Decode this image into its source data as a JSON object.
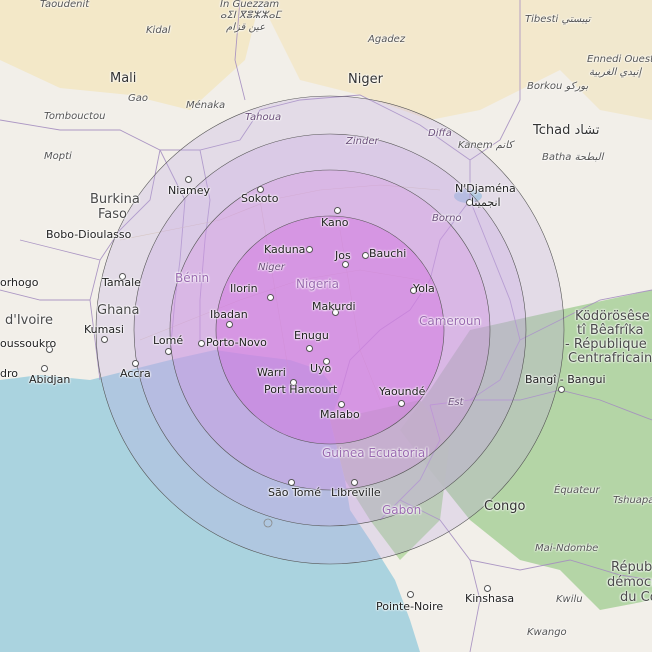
{
  "map": {
    "colors": {
      "land": "#f2efe9",
      "ocean": "#aad3df",
      "desert": "#f3e6bf",
      "forest": "#a9d09a",
      "border": "#a58ec0",
      "ring_outer": "#bfa9e2",
      "ring_inner": "#d36ee0"
    },
    "labels": [
      {
        "id": "taoudenit",
        "text": "Taoudenit",
        "cls": "ital-dark"
      },
      {
        "id": "in-guezzam-1",
        "text": "In Guezzam",
        "cls": "ital-dark"
      },
      {
        "id": "in-guezzam-2",
        "text": "ⴰⵉⵏ ⴳⴻⵣⵣⴰⵎ",
        "cls": "ital-dark"
      },
      {
        "id": "in-guezzam-3",
        "text": "عين قزام",
        "cls": "ital-dark"
      },
      {
        "id": "tibesti",
        "text": "Tibesti تيبستي",
        "cls": "ital-dark"
      },
      {
        "id": "kidal",
        "text": "Kidal",
        "cls": "ital-dark"
      },
      {
        "id": "agadez",
        "text": "Agadez",
        "cls": "ital-dark"
      },
      {
        "id": "ennedi-1",
        "text": "Ennedi Ouest",
        "cls": "ital-dark"
      },
      {
        "id": "ennedi-2",
        "text": "إنيدي الغربية",
        "cls": "ital-dark"
      },
      {
        "id": "mali",
        "text": "Mali",
        "cls": "country-big"
      },
      {
        "id": "niger",
        "text": "Niger",
        "cls": "country-big"
      },
      {
        "id": "borkou",
        "text": "Borkou بوركو",
        "cls": "ital-dark"
      },
      {
        "id": "gao",
        "text": "Gao",
        "cls": "ital-dark"
      },
      {
        "id": "menaka",
        "text": "Ménaka",
        "cls": "ital-dark"
      },
      {
        "id": "tombouctou",
        "text": "Tombouctou",
        "cls": "ital-dark"
      },
      {
        "id": "tahoua",
        "text": "Tahoua",
        "cls": "region"
      },
      {
        "id": "diffa",
        "text": "Diffa",
        "cls": "region"
      },
      {
        "id": "kanem",
        "text": "Kanem كانم",
        "cls": "ital-dark"
      },
      {
        "id": "tchad",
        "text": "Tchad تشاد",
        "cls": "country-big"
      },
      {
        "id": "zinder",
        "text": "Zinder",
        "cls": "region"
      },
      {
        "id": "batha",
        "text": "Batha البطحة",
        "cls": "ital-dark"
      },
      {
        "id": "mopti",
        "text": "Mopti",
        "cls": "ital-dark"
      },
      {
        "id": "niamey",
        "text": "Niamey",
        "cls": "city"
      },
      {
        "id": "ndjamena-1",
        "text": "N'Djaména",
        "cls": "city"
      },
      {
        "id": "ndjamena-2",
        "text": "انجمينا",
        "cls": "city"
      },
      {
        "id": "burkina-1",
        "text": "Burkina",
        "cls": "country"
      },
      {
        "id": "burkina-2",
        "text": "Faso",
        "cls": "country"
      },
      {
        "id": "sokoto",
        "text": "Sokoto",
        "cls": "city"
      },
      {
        "id": "borno",
        "text": "Borno",
        "cls": "region"
      },
      {
        "id": "kano",
        "text": "Kano",
        "cls": "city"
      },
      {
        "id": "bobo",
        "text": "Bobo-Dioulasso",
        "cls": "city"
      },
      {
        "id": "kaduna",
        "text": "Kaduna",
        "cls": "city"
      },
      {
        "id": "bauchi",
        "text": "Bauchi",
        "cls": "city"
      },
      {
        "id": "jos",
        "text": "Jos",
        "cls": "city"
      },
      {
        "id": "benin",
        "text": "Bénin",
        "cls": "purple-country"
      },
      {
        "id": "niger-region",
        "text": "Niger",
        "cls": "region"
      },
      {
        "id": "korhogo",
        "text": "orhogo",
        "cls": "city"
      },
      {
        "id": "tamale",
        "text": "Tamale",
        "cls": "city"
      },
      {
        "id": "nigeria",
        "text": "Nigeria",
        "cls": "purple-country"
      },
      {
        "id": "ilorin",
        "text": "Ilorin",
        "cls": "city"
      },
      {
        "id": "yola",
        "text": "Yola",
        "cls": "city"
      },
      {
        "id": "ghana",
        "text": "Ghana",
        "cls": "country"
      },
      {
        "id": "makurdi",
        "text": "Makurdi",
        "cls": "city"
      },
      {
        "id": "ivoire",
        "text": "d'Ivoire",
        "cls": "country"
      },
      {
        "id": "ibadan",
        "text": "Ibadan",
        "cls": "city"
      },
      {
        "id": "cameroun",
        "text": "Cameroun",
        "cls": "purple-country"
      },
      {
        "id": "kodorosese",
        "text": "Ködörösêse",
        "cls": "country"
      },
      {
        "id": "beafrika",
        "text": "tî Bêafrîka",
        "cls": "country"
      },
      {
        "id": "kumasi",
        "text": "Kumasi",
        "cls": "city"
      },
      {
        "id": "republique",
        "text": "- République",
        "cls": "country"
      },
      {
        "id": "enugu",
        "text": "Enugu",
        "cls": "city"
      },
      {
        "id": "yamoussoukro",
        "text": "oussoukro",
        "cls": "city"
      },
      {
        "id": "lome",
        "text": "Lomé",
        "cls": "city"
      },
      {
        "id": "porto-novo",
        "text": "Porto-Novo",
        "cls": "city"
      },
      {
        "id": "centrafricaine",
        "text": "Centrafricaine",
        "cls": "country"
      },
      {
        "id": "uyo",
        "text": "Uyo",
        "cls": "city"
      },
      {
        "id": "dro",
        "text": "dro",
        "cls": "city"
      },
      {
        "id": "abidjan",
        "text": "Abidjan",
        "cls": "city"
      },
      {
        "id": "accra",
        "text": "Accra",
        "cls": "city"
      },
      {
        "id": "warri",
        "text": "Warri",
        "cls": "city"
      },
      {
        "id": "bangui",
        "text": "Bangî - Bangui",
        "cls": "city"
      },
      {
        "id": "port-harcourt",
        "text": "Port Harcourt",
        "cls": "city"
      },
      {
        "id": "yaounde",
        "text": "Yaoundé",
        "cls": "city"
      },
      {
        "id": "est",
        "text": "Est",
        "cls": "region"
      },
      {
        "id": "malabo",
        "text": "Malabo",
        "cls": "city"
      },
      {
        "id": "guinea",
        "text": "Guinea Ecuatorial",
        "cls": "purple-country"
      },
      {
        "id": "equateur",
        "text": "Équateur",
        "cls": "ital-dark"
      },
      {
        "id": "tshuapa",
        "text": "Tshuapa",
        "cls": "ital-dark"
      },
      {
        "id": "sao-tome",
        "text": "São Tomé",
        "cls": "city"
      },
      {
        "id": "libreville",
        "text": "Libreville",
        "cls": "city"
      },
      {
        "id": "congo",
        "text": "Congo",
        "cls": "country-big"
      },
      {
        "id": "gabon",
        "text": "Gabon",
        "cls": "purple-country"
      },
      {
        "id": "mai-ndombe",
        "text": "Mai-Ndombe",
        "cls": "ital-dark"
      },
      {
        "id": "repub",
        "text": "Répub",
        "cls": "country"
      },
      {
        "id": "democr",
        "text": "démocr",
        "cls": "country"
      },
      {
        "id": "du-co",
        "text": "du Co",
        "cls": "country"
      },
      {
        "id": "kinshasa",
        "text": "Kinshasa",
        "cls": "city"
      },
      {
        "id": "pointe-noire",
        "text": "Pointe-Noire",
        "cls": "city"
      },
      {
        "id": "kwilu",
        "text": "Kwilu",
        "cls": "ital-dark"
      },
      {
        "id": "kwango",
        "text": "Kwango",
        "cls": "ital-dark"
      }
    ]
  }
}
